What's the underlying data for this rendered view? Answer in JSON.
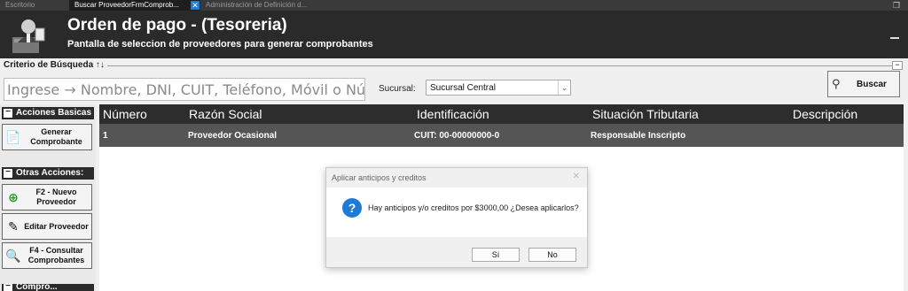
{
  "tabs": [
    {
      "label": "Escritorio"
    },
    {
      "label": "Buscar ProveedorFrmComprob...",
      "close": "✕"
    },
    {
      "label": "Administración de Definición d..."
    }
  ],
  "header": {
    "title": "Orden de pago - (Tesoreria)",
    "subtitle": "Pantalla de seleccion de proveedores para generar comprobantes"
  },
  "criteria": {
    "legend": "Criterio de Búsqueda ↑↓",
    "search_placeholder": "Ingrese → Nombre, DNI, CUIT, Teléfono, Móvil o Número",
    "sucursal_label": "Sucursal:",
    "sucursal_value": "Sucursal Central",
    "buscar_label": "Buscar"
  },
  "sidebar": {
    "acciones_basicas": "Acciones Basicas",
    "generar": "Generar Comprobante",
    "otras_acciones": "Otras Acciones:",
    "nuevo": "F2 - Nuevo Proveedor",
    "editar": "Editar Proveedor",
    "consultar": "F4 - Consultar Comprobantes",
    "comprobantes": "Compro..."
  },
  "grid": {
    "columns": [
      "Número",
      "Razón Social",
      "Identificación",
      "Situación Tributaria",
      "Descripción"
    ],
    "rows": [
      {
        "numero": "1",
        "razon": "Proveedor Ocasional",
        "id": "CUIT: 00-00000000-0",
        "situacion": "Responsable Inscripto",
        "descripcion": ""
      }
    ]
  },
  "dialog": {
    "title": "Aplicar anticipos y creditos",
    "message": "Hay anticipos y/o creditos por $3000,00 ¿Desea aplicarlos?",
    "yes": "Sí",
    "no": "No",
    "icon": "?"
  }
}
